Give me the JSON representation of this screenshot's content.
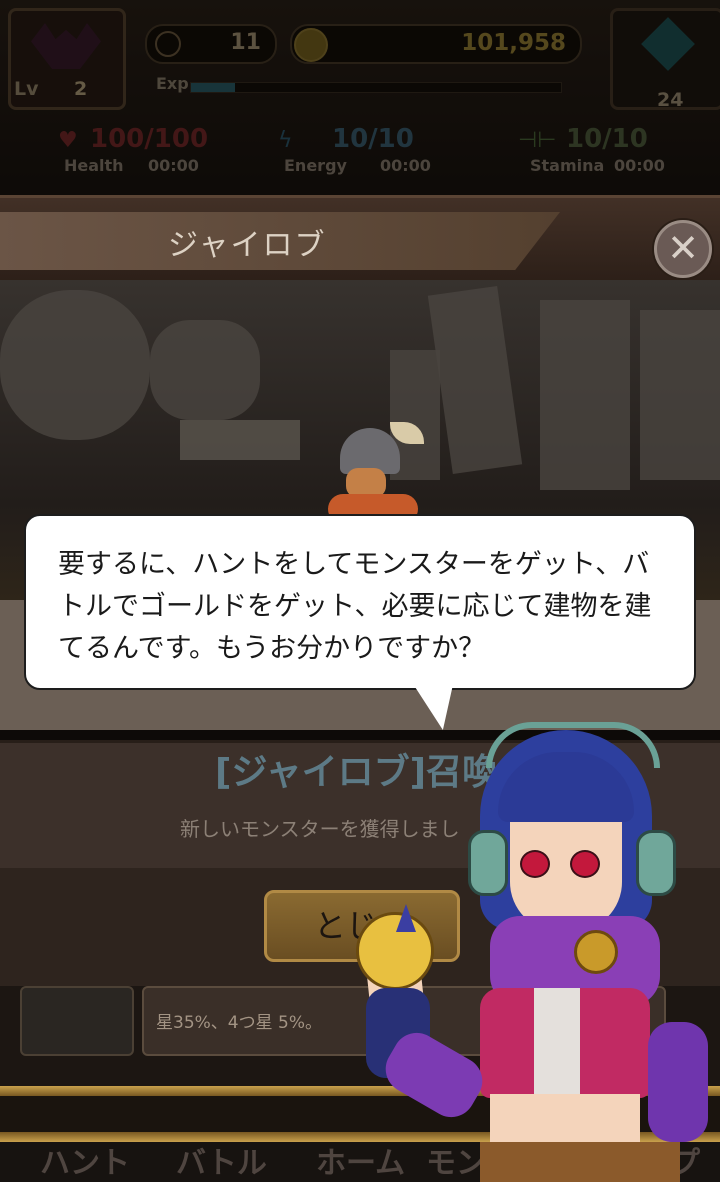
{
  "hud": {
    "level_label": "Lv",
    "level_value": "2",
    "rank_value": "11",
    "gold_value": "101,958",
    "exp_label": "Exp",
    "exp_progress": 0.12,
    "gem_value": "24",
    "stats": [
      {
        "label": "Health",
        "value": "100/100",
        "timer": "00:00",
        "color": "#7a2a2a",
        "icon": "heart-icon"
      },
      {
        "label": "Energy",
        "value": "10/10",
        "timer": "00:00",
        "color": "#2f5a6e",
        "icon": "lightning-icon"
      },
      {
        "label": "Stamina",
        "value": "10/10",
        "timer": "00:00",
        "color": "#4d6a3a",
        "icon": "dumbbell-icon"
      }
    ]
  },
  "modal": {
    "title": "ジャイロブ",
    "panel_text": "",
    "summon_title": "[ジャイロブ]召喚",
    "summon_sub": "新しいモンスターを獲得しまし",
    "close_button": "とじる",
    "info_text": "星35%、4つ星 5%。"
  },
  "dialog": {
    "text": "要するに、ハントをしてモンスターをゲット、バトルでゴールドをゲット、必要に応じて建物を建てるんです。もうお分かりですか？"
  },
  "nav": {
    "items": [
      "ハント",
      "バトル",
      "ホーム",
      "モンスター",
      "ショップ"
    ]
  },
  "colors": {
    "accent_gold": "#c9a14c",
    "bubble_bg": "#ffffff",
    "hair": "#2d3f9e"
  }
}
